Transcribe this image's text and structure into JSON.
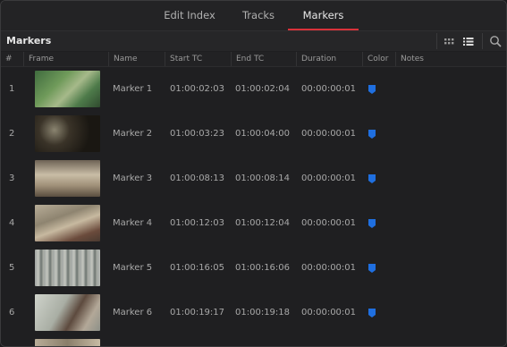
{
  "tabs": [
    {
      "label": "Edit Index",
      "active": false
    },
    {
      "label": "Tracks",
      "active": false
    },
    {
      "label": "Markers",
      "active": true
    }
  ],
  "panel_title": "Markers",
  "columns": [
    "#",
    "Frame",
    "Name",
    "Start TC",
    "End TC",
    "Duration",
    "Color",
    "Notes"
  ],
  "accent_color": "#d9323a",
  "marker_color": "#1f6fe0",
  "rows": [
    {
      "num": "1",
      "name": "Marker 1",
      "start": "01:00:02:03",
      "end": "01:00:02:04",
      "duration": "00:00:00:01"
    },
    {
      "num": "2",
      "name": "Marker 2",
      "start": "01:00:03:23",
      "end": "01:00:04:00",
      "duration": "00:00:00:01"
    },
    {
      "num": "3",
      "name": "Marker 3",
      "start": "01:00:08:13",
      "end": "01:00:08:14",
      "duration": "00:00:00:01"
    },
    {
      "num": "4",
      "name": "Marker 4",
      "start": "01:00:12:03",
      "end": "01:00:12:04",
      "duration": "00:00:00:01"
    },
    {
      "num": "5",
      "name": "Marker 5",
      "start": "01:00:16:05",
      "end": "01:00:16:06",
      "duration": "00:00:00:01"
    },
    {
      "num": "6",
      "name": "Marker 6",
      "start": "01:00:19:17",
      "end": "01:00:19:18",
      "duration": "00:00:00:01"
    }
  ],
  "icons": {
    "grid_view": "grid-view-icon",
    "list_view": "list-view-icon",
    "search": "search-icon",
    "marker": "marker-flag-icon"
  }
}
